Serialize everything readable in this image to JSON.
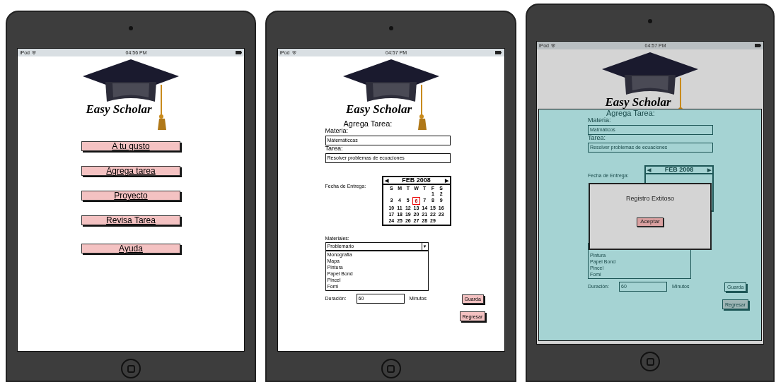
{
  "screens": [
    {
      "kind": "menu",
      "dimmed": false,
      "status_bar": {
        "carrier": "iPod",
        "time": "04:56 PM"
      },
      "logo": {
        "title": "Easy Scholar"
      },
      "buttons": [
        "A tu gusto",
        "Agrega tarea",
        "Proyecto",
        "Revisa Tarea",
        "Ayuda"
      ]
    },
    {
      "kind": "form",
      "dimmed": false,
      "status_bar": {
        "carrier": "iPod",
        "time": "04:57 PM"
      },
      "logo": {
        "title": "Easy Scholar"
      },
      "heading": "Agrega Tarea:",
      "fields": [
        {
          "label": "Materia:",
          "value": "Mátemáticcas"
        },
        {
          "label": "Tarea:",
          "value": "Resolver problemas de ecuaciones"
        }
      ],
      "date": {
        "label": "Fecha de Entrega:",
        "calendar": {
          "prev": "◀",
          "month": "FEB 2008",
          "next": "▶",
          "weekdays": [
            "S",
            "M",
            "T",
            "W",
            "T",
            "F",
            "S"
          ],
          "weeks": [
            [
              {
                "day": "1",
                "selected": false
              },
              {
                "day": "2",
                "selected": false
              }
            ],
            [
              {
                "day": "3",
                "selected": false
              },
              {
                "day": "4",
                "selected": false
              },
              {
                "day": "5",
                "selected": false
              },
              {
                "day": "6",
                "selected": true
              },
              {
                "day": "7",
                "selected": false
              },
              {
                "day": "8",
                "selected": false
              },
              {
                "day": "9",
                "selected": false
              }
            ],
            [
              {
                "day": "10",
                "selected": false
              },
              {
                "day": "11",
                "selected": false
              },
              {
                "day": "12",
                "selected": false
              },
              {
                "day": "13",
                "selected": false
              },
              {
                "day": "14",
                "selected": false
              },
              {
                "day": "15",
                "selected": false
              },
              {
                "day": "16",
                "selected": false
              }
            ],
            [
              {
                "day": "17",
                "selected": false
              },
              {
                "day": "18",
                "selected": false
              },
              {
                "day": "19",
                "selected": false
              },
              {
                "day": "20",
                "selected": false
              },
              {
                "day": "21",
                "selected": false
              },
              {
                "day": "22",
                "selected": false
              },
              {
                "day": "23",
                "selected": false
              }
            ],
            [
              {
                "day": "24",
                "selected": false
              },
              {
                "day": "25",
                "selected": false
              },
              {
                "day": "26",
                "selected": false
              },
              {
                "day": "27",
                "selected": false
              },
              {
                "day": "28",
                "selected": false
              },
              {
                "day": "29",
                "selected": false
              }
            ]
          ]
        }
      },
      "materials": {
        "label": "Materiales:",
        "value": "Problemario",
        "arrow": "▼",
        "expanded": true,
        "options": [
          "Monografia",
          "Mapa",
          "Pintura",
          "Papel Bond",
          "Pincel",
          "Fomi"
        ]
      },
      "duration": {
        "label": "Duración:",
        "value": "60",
        "unit": "Minutos"
      },
      "buttons": [
        "Guarda",
        "Regresar"
      ]
    },
    {
      "kind": "form",
      "dimmed": true,
      "status_bar": {
        "carrier": "iPod",
        "time": "04:57 PM"
      },
      "logo": {
        "title": "Easy Scholar"
      },
      "heading": "Agrega Tarea:",
      "fields": [
        {
          "label": "Materia:",
          "value": "Matmáticos"
        },
        {
          "label": "Tarea:",
          "value": "Resolver problemas de ecuaciones"
        }
      ],
      "date": {
        "label": "Fecha de Entrega:",
        "calendar": {
          "prev": "◀",
          "month": "FEB 2008",
          "next": "▶"
        }
      },
      "materials": {
        "expanded": true,
        "options": [
          "Pintura",
          "Papel Bond",
          "Pincel",
          "Fomi"
        ]
      },
      "duration": {
        "label": "Duración:",
        "value": "60",
        "unit": "Minutos"
      },
      "buttons": [
        "Guarda",
        "Regresar"
      ],
      "dialog": {
        "message": "Registro Extitoso",
        "button": "Aceptar"
      }
    }
  ]
}
